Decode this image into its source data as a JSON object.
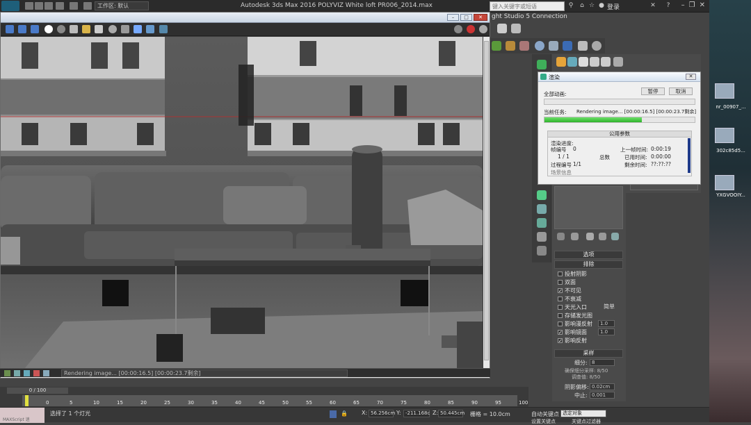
{
  "titlebar": {
    "workspace_label": "工作区: 默认",
    "app_title": "Autodesk 3ds Max 2016      POLYVIZ White loft PR006_2014.max",
    "search_placeholder": "键入关键字或短语",
    "login_label": "登录"
  },
  "connection_label": "ght Studio 5 Connection",
  "frame_buffer": {
    "status_text": "Rendering image... [00:00:16.5] [00:00:23.7剩余]"
  },
  "render_dialog": {
    "title": "渲染",
    "all_anim_label": "全部动画:",
    "pause_label": "暂停",
    "cancel_label": "取消",
    "current_task_label": "当前任务:",
    "current_task_text": "Rendering image... [00:00:16.5] [00:00:23.7剩余]",
    "current_task_progress": 0.65,
    "all_anim_progress": 0.0,
    "params_header": "公用参数",
    "render_progress_label": "渲染进度:",
    "frame_no_label": "帧编号",
    "frame_no": "0",
    "frame_count": "1 / 1",
    "total_label": "总数",
    "pass_label": "过程编号",
    "pass_value": "1/1",
    "last_frame_time_label": "上一帧时间:",
    "last_frame_time": "0:00:19",
    "elapsed_label": "已用时间:",
    "elapsed_time": "0:00:00",
    "remaining_label": "剩余时间:",
    "remaining_time": "??:??:??",
    "scene_info_label": "场景信息"
  },
  "options": {
    "header": "选项",
    "exclude_label": "排除",
    "items": [
      {
        "label": "投射阴影",
        "checked": false
      },
      {
        "label": "双面",
        "checked": false
      },
      {
        "label": "不可见",
        "checked": true
      },
      {
        "label": "不衰减",
        "checked": false
      },
      {
        "label": "天光入口",
        "checked": false
      },
      {
        "label": "存储发光图",
        "checked": false
      },
      {
        "label": "影响漫反射",
        "checked": false
      },
      {
        "label": "影响镜面",
        "checked": true
      },
      {
        "label": "影响反射",
        "checked": true
      }
    ],
    "simple_label": "简单",
    "diffuse_value": "1.0",
    "specular_value": "1.0"
  },
  "sampling": {
    "header": "采样",
    "subdiv_label": "细分:",
    "subdiv_value": "8",
    "note1": "确保细分采样: 8/50",
    "note2": "调查值: 8/50",
    "shadow_bias_label": "阴影偏移:",
    "shadow_bias_value": "0.02cm",
    "cutoff_label": "中止:",
    "cutoff_value": "0.001"
  },
  "timeline": {
    "frame_indicator": "0 / 100",
    "ticks": [
      "0",
      "5",
      "10",
      "15",
      "20",
      "25",
      "30",
      "35",
      "40",
      "45",
      "50",
      "55",
      "60",
      "65",
      "70",
      "75",
      "80",
      "85",
      "90",
      "95",
      "100"
    ]
  },
  "statusbar": {
    "maxscript_label": "MAXScript 迷",
    "selected_msg": "选择了 1 个灯光",
    "x_label": "X:",
    "x_value": "56.256cm",
    "y_label": "Y:",
    "y_value": "-211.168c",
    "z_label": "Z:",
    "z_value": "50.445cm",
    "grid_label": "栅格 = 10.0cm",
    "autokey_label": "自动关键点",
    "selected_obj": "选定对象",
    "setkey_label": "设置关键点",
    "key_filter_label": "关键点过滤器"
  },
  "desktop": {
    "icons": [
      {
        "label": "nr_00907_..."
      },
      {
        "label": "302c85d5..."
      },
      {
        "label": "YXGVOOIY..."
      }
    ]
  },
  "colors": {
    "progress_green": "#2db22a",
    "accent_blue": "#1e5f7a"
  }
}
